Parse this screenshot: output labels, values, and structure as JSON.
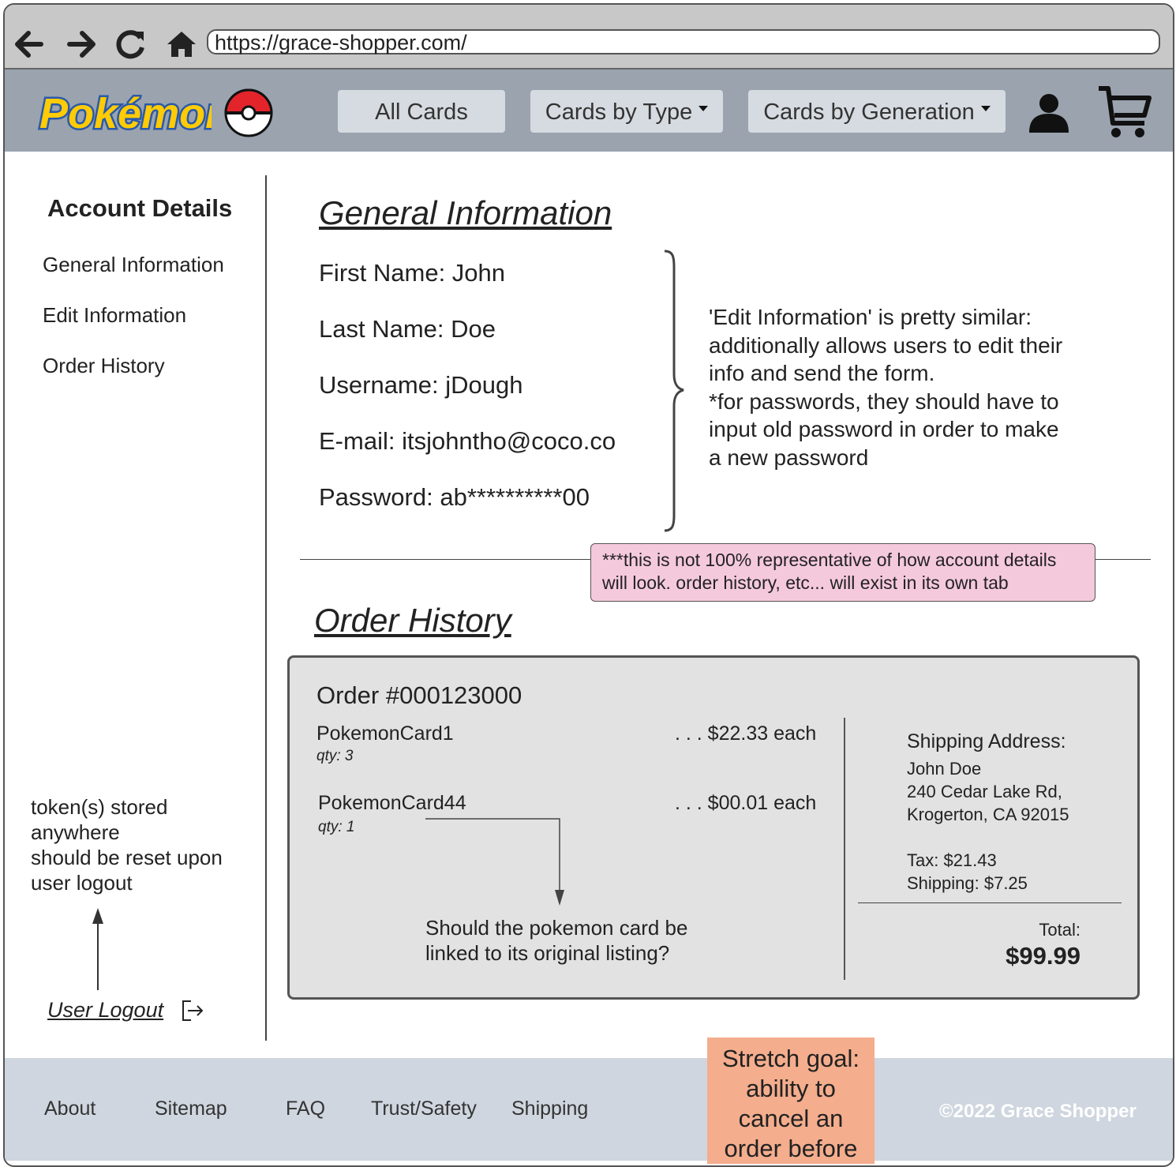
{
  "browser": {
    "url": "https://grace-shopper.com/",
    "icons": [
      "back-arrow-icon",
      "forward-arrow-icon",
      "reload-icon",
      "home-icon"
    ]
  },
  "header": {
    "logo_text": "Pokémon",
    "nav": [
      {
        "label": "All Cards"
      },
      {
        "label": "Cards by Type"
      },
      {
        "label": "Cards by Generation"
      }
    ]
  },
  "sidebar": {
    "title": "Account Details",
    "links": [
      "General Information",
      "Edit Information",
      "Order History"
    ],
    "token_note": [
      "token(s) stored",
      "anywhere",
      "should be reset upon",
      "user logout"
    ],
    "logout_label": "User Logout"
  },
  "general": {
    "heading": "General Information",
    "fields": [
      "First Name: John",
      "Last Name: Doe",
      "Username: jDough",
      "E-mail: itsjohntho@coco.co",
      "Password: ab**********00"
    ],
    "edit_note": [
      "'Edit Information' is pretty similar:",
      "additionally allows users to edit their",
      "info and send the form.",
      "*for passwords, they should have to",
      "input old password in order to make",
      "a new password"
    ],
    "pink_note": [
      "***this is not 100% representative of how account details",
      "will look. order history, etc... will exist in its own tab"
    ]
  },
  "orders": {
    "heading": "Order History",
    "order_number": "Order #000123000",
    "items": [
      {
        "name": "PokemonCard1",
        "qty": "qty: 3",
        "price": ". . . $22.33 each"
      },
      {
        "name": "PokemonCard44",
        "qty": "qty: 1",
        "price": ". . . $00.01 each"
      }
    ],
    "link_question": [
      "Should the pokemon card be",
      "linked to its original listing?"
    ],
    "shipping_label": "Shipping Address:",
    "address": [
      "John Doe",
      "240 Cedar Lake Rd,",
      "Krogerton, CA 92015"
    ],
    "tax": "Tax: $21.43",
    "shipping": "Shipping: $7.25",
    "total_label": "Total:",
    "total": "$99.99"
  },
  "footer": {
    "links": [
      "About",
      "Sitemap",
      "FAQ",
      "Trust/Safety",
      "Shipping"
    ],
    "copyright": "©2022 Grace Shopper",
    "stretch_note": [
      "Stretch goal:",
      "ability to",
      "cancel an",
      "order before"
    ]
  },
  "colors": {
    "header_bg": "#9aa3ae",
    "nav_button_bg": "#d6dbe1",
    "pink_note_bg": "#f5c9dc",
    "stretch_note_bg": "#f4ad8d",
    "footer_bg": "#cfd6df"
  }
}
